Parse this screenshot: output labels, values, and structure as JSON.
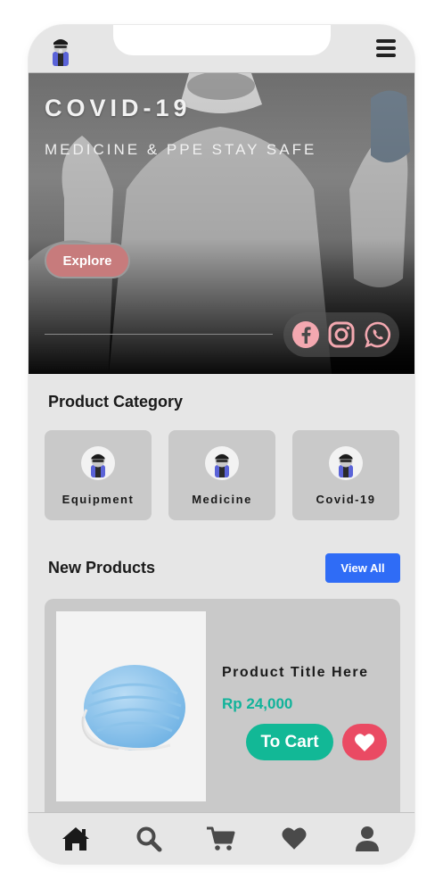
{
  "hero": {
    "title": "COVID-19",
    "subtitle": "MEDICINE & PPE STAY SAFE",
    "explore_label": "Explore",
    "social": [
      "facebook-icon",
      "instagram-icon",
      "whatsapp-icon"
    ]
  },
  "categories": {
    "title": "Product Category",
    "items": [
      {
        "label": "Equipment"
      },
      {
        "label": "Medicine"
      },
      {
        "label": "Covid-19"
      }
    ]
  },
  "new_products": {
    "title": "New Products",
    "view_all_label": "View All",
    "items": [
      {
        "title": "Product Title Here",
        "price": "Rp 24,000",
        "cart_label": "To Cart"
      }
    ]
  },
  "bottom_nav": [
    "home-icon",
    "search-icon",
    "cart-icon",
    "heart-icon",
    "user-icon"
  ],
  "colors": {
    "accent_blue": "#2f6cf6",
    "accent_green": "#12b896",
    "accent_red": "#ea4a63",
    "explore_pink": "#c77b7c",
    "social_pink": "#f3a8b0"
  }
}
